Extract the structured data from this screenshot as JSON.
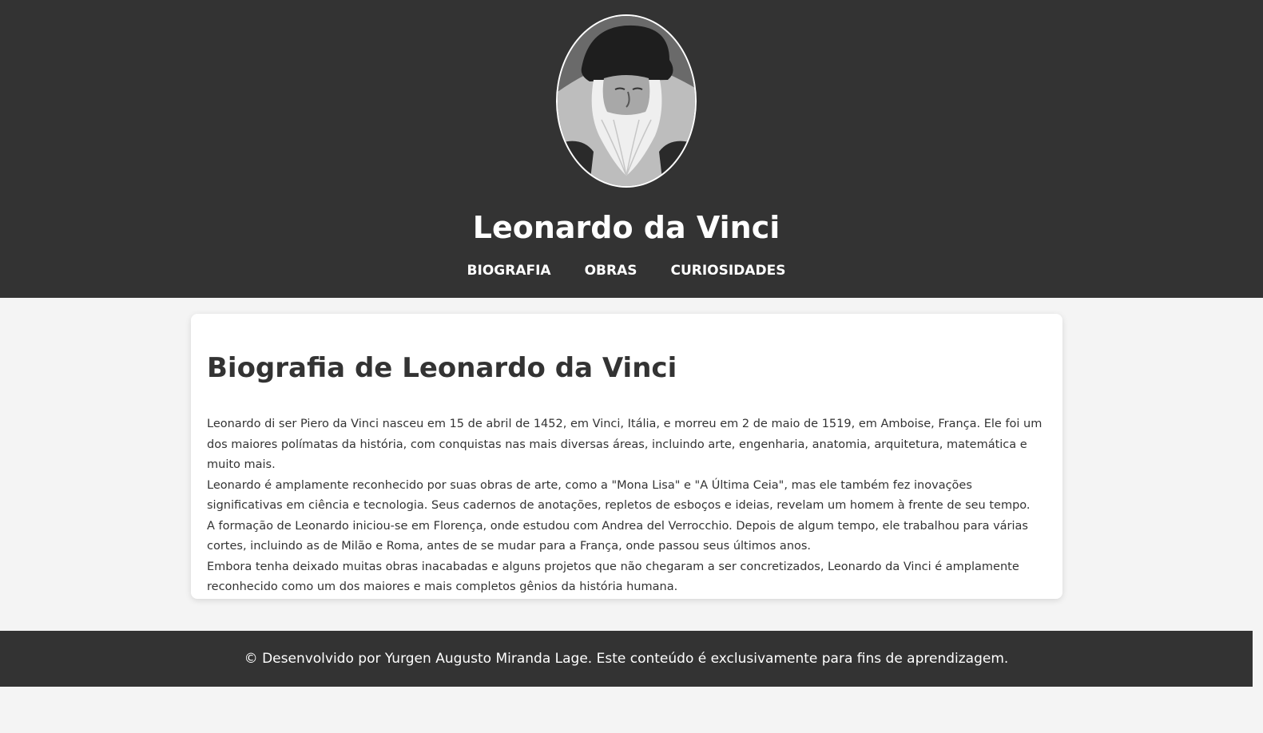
{
  "header": {
    "title": "Leonardo da Vinci",
    "portrait_icon": "portrait-image",
    "nav": [
      {
        "label": "BIOGRAFIA"
      },
      {
        "label": "OBRAS"
      },
      {
        "label": "CURIOSIDADES"
      }
    ]
  },
  "main": {
    "heading": "Biografia de Leonardo da Vinci",
    "paragraphs": [
      "Leonardo di ser Piero da Vinci nasceu em 15 de abril de 1452, em Vinci, Itália, e morreu em 2 de maio de 1519, em Amboise, França. Ele foi um dos maiores polímatas da história, com conquistas nas mais diversas áreas, incluindo arte, engenharia, anatomia, arquitetura, matemática e muito mais.",
      "Leonardo é amplamente reconhecido por suas obras de arte, como a \"Mona Lisa\" e \"A Última Ceia\", mas ele também fez inovações significativas em ciência e tecnologia. Seus cadernos de anotações, repletos de esboços e ideias, revelam um homem à frente de seu tempo.",
      "A formação de Leonardo iniciou-se em Florença, onde estudou com Andrea del Verrocchio. Depois de algum tempo, ele trabalhou para várias cortes, incluindo as de Milão e Roma, antes de se mudar para a França, onde passou seus últimos anos.",
      "Embora tenha deixado muitas obras inacabadas e alguns projetos que não chegaram a ser concretizados, Leonardo da Vinci é amplamente reconhecido como um dos maiores e mais completos gênios da história humana."
    ]
  },
  "footer": {
    "text": "© Desenvolvido por Yurgen Augusto Miranda Lage. Este conteúdo é exclusivamente para fins de aprendizagem."
  },
  "colors": {
    "header_bg": "#333333",
    "page_bg": "#f4f4f4",
    "card_bg": "#ffffff",
    "text": "#333333",
    "header_text": "#ffffff"
  }
}
